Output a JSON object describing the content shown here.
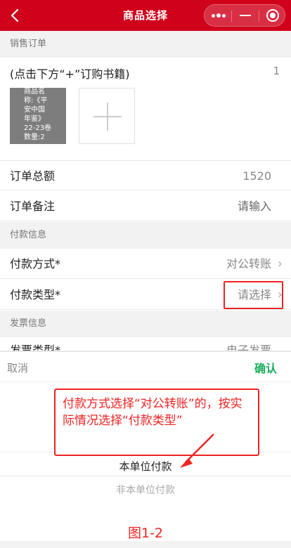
{
  "header": {
    "title": "商品选择",
    "back_icon": "chevron-left",
    "capsule": {
      "more_icon": "more-dots",
      "minimize_icon": "minus",
      "close_icon": "target-circle"
    }
  },
  "sales_order": {
    "section_title": "销售订单",
    "hint": "(点击下方“+”订购书籍)",
    "count": "1",
    "book_card_text": "商品名\n称:《平\n安中国\n年鉴》\n22-23卷\n数量:2",
    "add_icon": "plus"
  },
  "order_total": {
    "label": "订单总额",
    "value": "1520"
  },
  "order_note": {
    "label": "订单备注",
    "placeholder": "请输入"
  },
  "payment_info": {
    "section_title": "付款信息",
    "method": {
      "label": "付款方式*",
      "value": "对公转账"
    },
    "type": {
      "label": "付款类型*",
      "value": "请选择"
    }
  },
  "invoice_info": {
    "section_title": "发票信息",
    "type_label_partial": "发票类型*",
    "type_value_partial": "电子发票"
  },
  "picker": {
    "cancel": "取消",
    "confirm": "确认",
    "options": [
      "本单位付款",
      "非本单位付款"
    ]
  },
  "annotation": {
    "note": "付款方式选择“对公转账”的，按实际情况选择“付款类型”",
    "figure_label": "图1-2",
    "color": "#e22222"
  },
  "colors": {
    "header_bg": "#d0021b",
    "confirm": "#1aad5c"
  }
}
